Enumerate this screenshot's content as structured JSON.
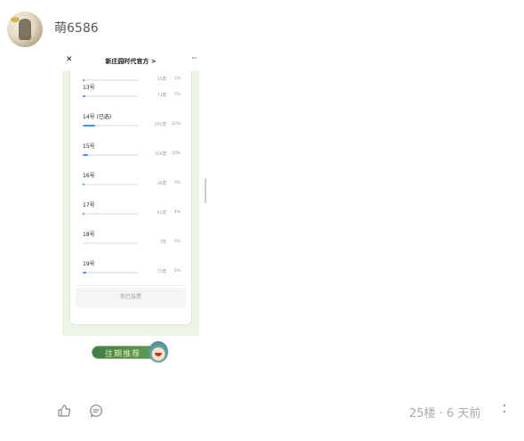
{
  "post": {
    "username": "萌6586",
    "floor": "25楼",
    "separator": "·",
    "time": "6 天前"
  },
  "screenshot": {
    "title": "新庄园时代官方 >",
    "close_glyph": "✕",
    "more_glyph": "···",
    "voted_text": "你已投票",
    "rows": [
      {
        "label": "",
        "count": "15票",
        "pct": "1%",
        "fill": 0.01
      },
      {
        "label": "13号",
        "count": "73票",
        "pct": "5%",
        "fill": 0.05
      },
      {
        "label": "14号 (已选)",
        "count": "291票",
        "pct": "22%",
        "fill": 0.22,
        "selected": true
      },
      {
        "label": "15号",
        "count": "126票",
        "pct": "10%",
        "fill": 0.1
      },
      {
        "label": "16号",
        "count": "38票",
        "pct": "3%",
        "fill": 0.03
      },
      {
        "label": "17号",
        "count": "61票",
        "pct": "4%",
        "fill": 0.04
      },
      {
        "label": "18号",
        "count": "7票",
        "pct": "0%",
        "fill": 0.0
      },
      {
        "label": "19号",
        "count": "75票",
        "pct": "6%",
        "fill": 0.06
      }
    ]
  },
  "banner": {
    "text": "往期推荐"
  },
  "icons": {
    "like": "thumbs-up-icon",
    "comment": "comment-icon",
    "more": "more-vertical-icon"
  },
  "colors": {
    "bar_fill": "#4c8ef7",
    "phone_bg": "#eef5e7",
    "banner_green": "#3f7d4a"
  }
}
